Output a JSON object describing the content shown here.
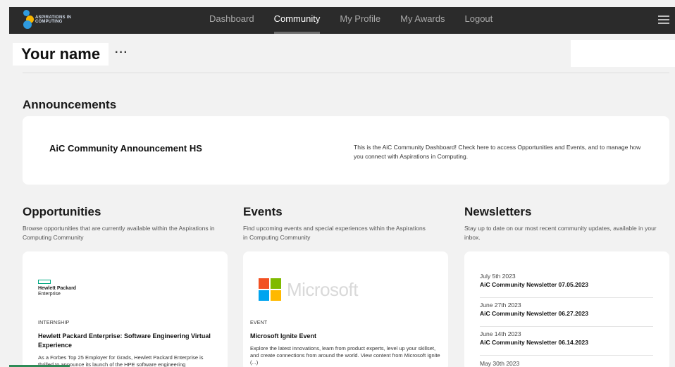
{
  "header": {
    "logo_text": "Aspirations in Computing",
    "nav": [
      "Dashboard",
      "Community",
      "My Profile",
      "My Awards",
      "Logout"
    ],
    "active_nav": "Community",
    "menu_icon": "hamburger-menu-icon"
  },
  "profile": {
    "name": "Your name",
    "more": "···"
  },
  "announcements": {
    "heading": "Announcements",
    "title": "AiC Community Announcement HS",
    "text": "This is the AiC Community Dashboard! Check here to access Opportunities and Events, and to manage how you connect with Aspirations in Computing."
  },
  "opportunities": {
    "heading": "Opportunities",
    "description": "Browse opportunities that are currently available within the Aspirations in Computing Community",
    "card": {
      "logo_name": "Hewlett Packard",
      "logo_sub": "Enterprise",
      "tag": "INTERNSHIP",
      "title": "Hewlett Packard Enterprise: Software Engineering Virtual Experience",
      "desc": "As a Forbes Top 25 Employer for Grads, Hewlett Packard Enterprise is thrilled to announce its launch of the HPE software engineering"
    }
  },
  "events": {
    "heading": "Events",
    "description": "Find upcoming events and special experiences within the Aspirations in Computing Community",
    "card": {
      "logo_word": "Microsoft",
      "tag": "EVENT",
      "title": "Microsoft Ignite Event",
      "desc": "Explore the latest innovations, learn from product experts, level up your skillset, and create connections from around the world. View content from Microsoft Ignite (...)"
    }
  },
  "newsletters": {
    "heading": "Newsletters",
    "description": "Stay up to date on our most recent community updates, available in your inbox.",
    "items": [
      {
        "date": "July 5th 2023",
        "title": "AiC Community Newsletter 07.05.2023"
      },
      {
        "date": "June 27th 2023",
        "title": "AiC Community Newsletter 06.27.2023"
      },
      {
        "date": "June 14th 2023",
        "title": "AiC Community Newsletter 06.14.2023"
      },
      {
        "date": "May 30th 2023",
        "title": ""
      }
    ]
  },
  "colors": {
    "nav_bg": "#2b2b2b",
    "page_bg": "#f2f2f2",
    "hpe_green": "#01a982"
  }
}
